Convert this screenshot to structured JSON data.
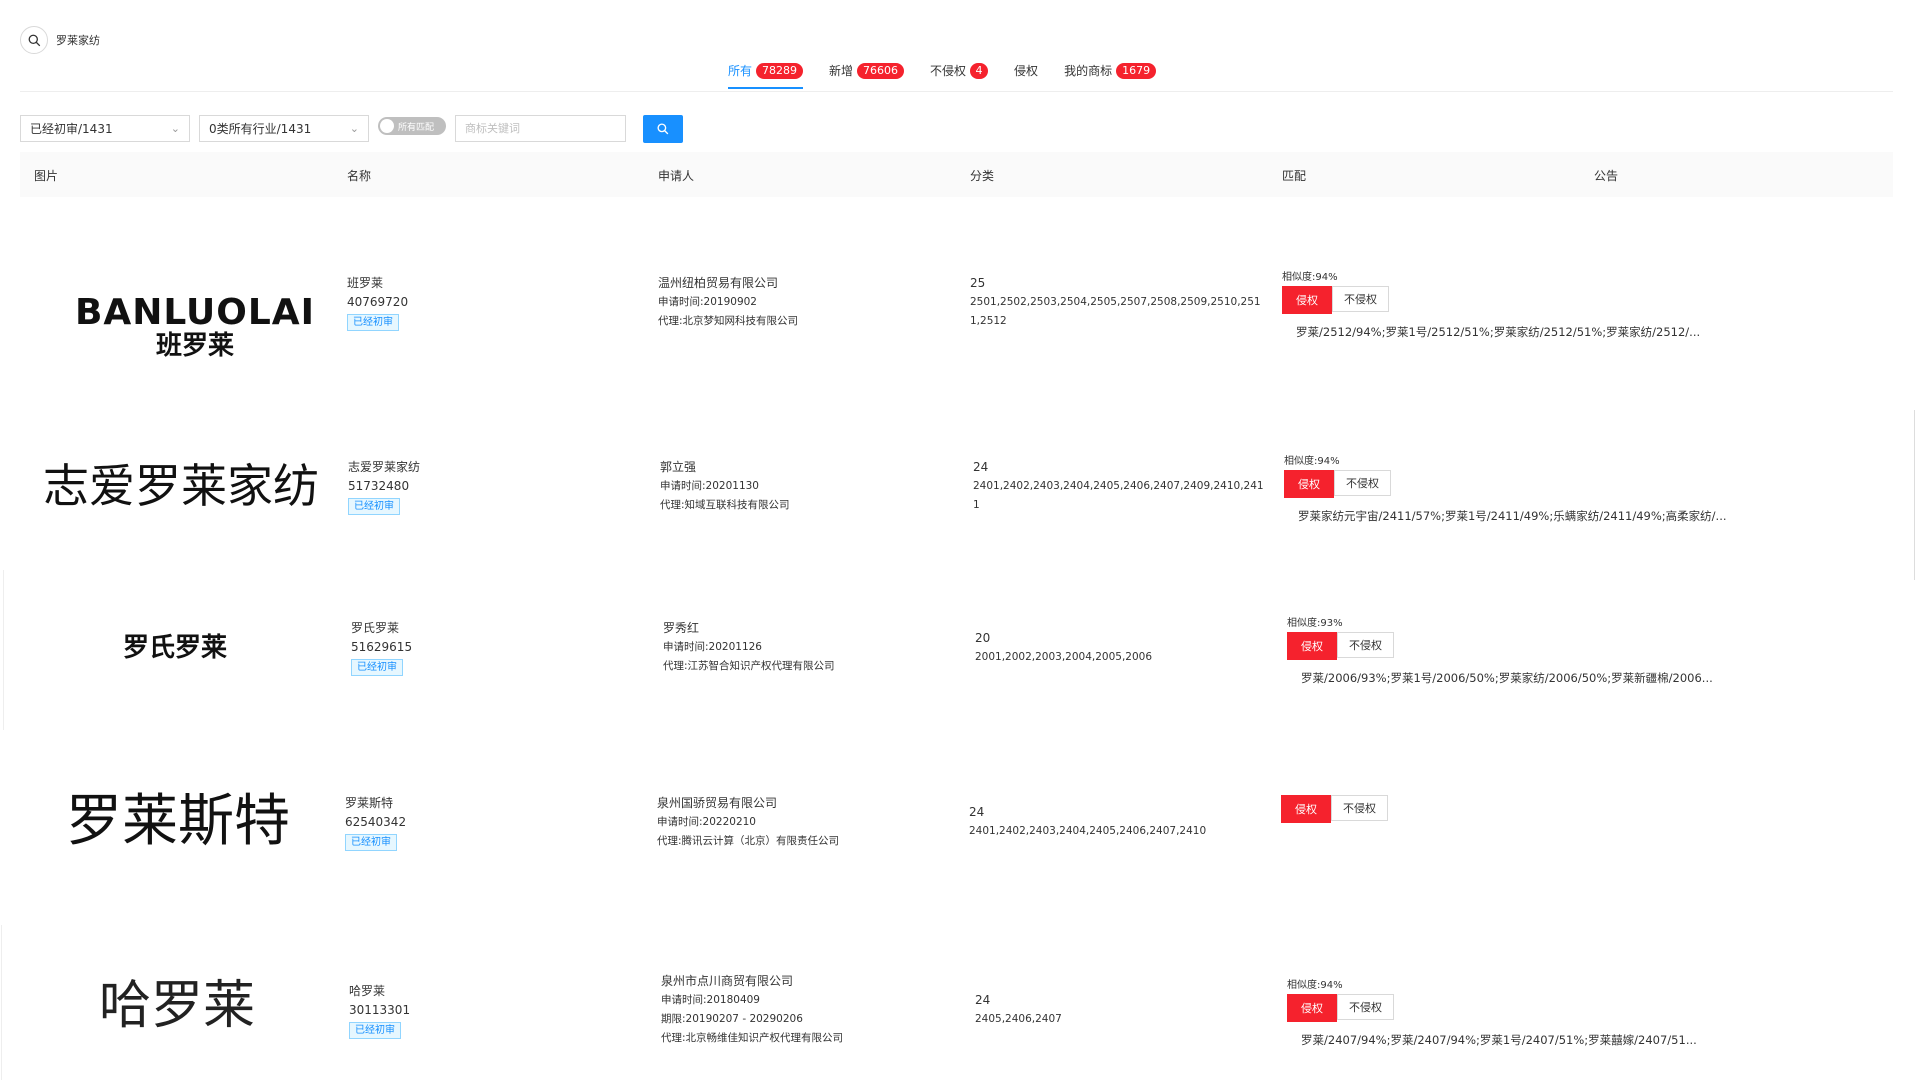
{
  "search": {
    "query": "罗莱家纺",
    "icon": "search-icon"
  },
  "tabs": [
    {
      "label": "所有",
      "count": "78289",
      "active": true
    },
    {
      "label": "新增",
      "count": "76606",
      "active": false
    },
    {
      "label": "不侵权",
      "count": "4",
      "active": false
    },
    {
      "label": "侵权",
      "count": "",
      "active": false
    },
    {
      "label": "我的商标",
      "count": "1679",
      "active": false
    }
  ],
  "filters": {
    "status_select": "已经初审/1431",
    "industry_select": "0类所有行业/1431",
    "toggle_label": "所有匹配",
    "keyword_placeholder": "商标关键词"
  },
  "table": {
    "headers": [
      "图片",
      "名称",
      "申请人",
      "分类",
      "匹配",
      "公告"
    ],
    "rows": [
      {
        "logo_text": "BANLUOLAI",
        "logo_sub": "班罗莱",
        "name": "班罗莱",
        "reg_no": "40769720",
        "status": "已经初审",
        "applicant": "温州纽柏贸易有限公司",
        "apply_date": "申请时间:20190902",
        "period": "",
        "agent": "代理:北京梦知网科技有限公司",
        "class": "25",
        "codes": "2501,2502,2503,2504,2505,2507,2508,2509,2510,2511,2512",
        "similarity": "相似度:94%",
        "infringe_label": "侵权",
        "not_infringe_label": "不侵权",
        "match_text": "罗莱/2512/94%;罗莱1号/2512/51%;罗莱家纺/2512/51%;罗莱家纺/2512/..."
      },
      {
        "logo_text": "志爱罗莱家纺",
        "logo_sub": "",
        "name": "志爱罗莱家纺",
        "reg_no": "51732480",
        "status": "已经初审",
        "applicant": "郭立强",
        "apply_date": "申请时间:20201130",
        "period": "",
        "agent": "代理:知域互联科技有限公司",
        "class": "24",
        "codes": "2401,2402,2403,2404,2405,2406,2407,2409,2410,2411",
        "similarity": "相似度:94%",
        "infringe_label": "侵权",
        "not_infringe_label": "不侵权",
        "match_text": "罗莱家纺元宇宙/2411/57%;罗莱1号/2411/49%;乐螨家纺/2411/49%;高柔家纺/..."
      },
      {
        "logo_text": "罗氏罗莱",
        "logo_sub": "",
        "name": "罗氏罗莱",
        "reg_no": "51629615",
        "status": "已经初审",
        "applicant": "罗秀红",
        "apply_date": "申请时间:20201126",
        "period": "",
        "agent": "代理:江苏智合知识产权代理有限公司",
        "class": "20",
        "codes": "2001,2002,2003,2004,2005,2006",
        "similarity": "相似度:93%",
        "infringe_label": "侵权",
        "not_infringe_label": "不侵权",
        "match_text": "罗莱/2006/93%;罗莱1号/2006/50%;罗莱家纺/2006/50%;罗莱新疆棉/2006..."
      },
      {
        "logo_text": "罗莱斯特",
        "logo_sub": "",
        "name": "罗莱斯特",
        "reg_no": "62540342",
        "status": "已经初审",
        "applicant": "泉州国骄贸易有限公司",
        "apply_date": "申请时间:20220210",
        "period": "",
        "agent": "代理:腾讯云计算（北京）有限责任公司",
        "class": "24",
        "codes": "2401,2402,2403,2404,2405,2406,2407,2410",
        "similarity": "",
        "infringe_label": "侵权",
        "not_infringe_label": "不侵权",
        "match_text": ""
      },
      {
        "logo_text": "哈罗莱",
        "logo_sub": "",
        "name": "哈罗莱",
        "reg_no": "30113301",
        "status": "已经初审",
        "applicant": "泉州市点川商贸有限公司",
        "apply_date": "申请时间:20180409",
        "period": "期限:20190207 - 20290206",
        "agent": "代理:北京畅维佳知识产权代理有限公司",
        "class": "24",
        "codes": "2405,2406,2407",
        "similarity": "相似度:94%",
        "infringe_label": "侵权",
        "not_infringe_label": "不侵权",
        "match_text": "罗莱/2407/94%;罗莱/2407/94%;罗莱1号/2407/51%;罗莱囍嫁/2407/51..."
      }
    ]
  },
  "colors": {
    "accent": "#1890ff",
    "danger": "#f5222d"
  }
}
